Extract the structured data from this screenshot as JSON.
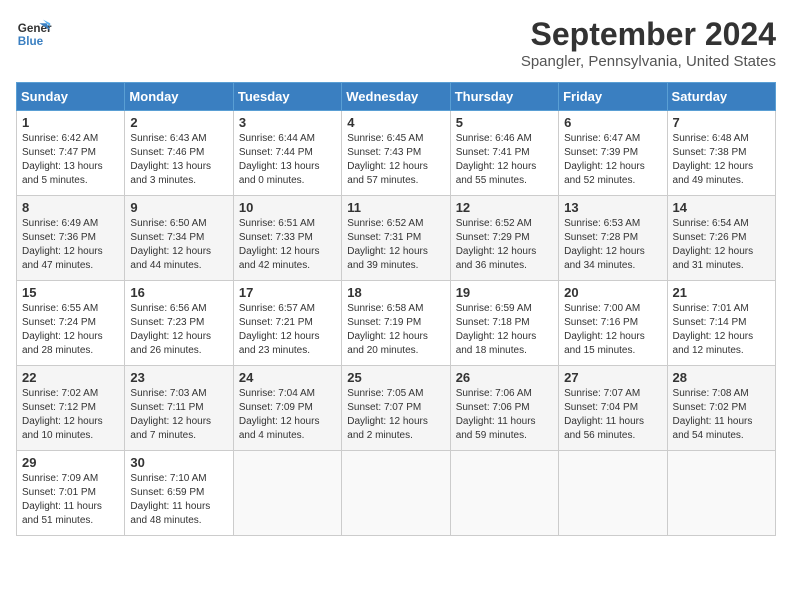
{
  "header": {
    "logo_line1": "General",
    "logo_line2": "Blue",
    "month": "September 2024",
    "location": "Spangler, Pennsylvania, United States"
  },
  "days_of_week": [
    "Sunday",
    "Monday",
    "Tuesday",
    "Wednesday",
    "Thursday",
    "Friday",
    "Saturday"
  ],
  "weeks": [
    [
      {
        "day": "1",
        "sunrise": "6:42 AM",
        "sunset": "7:47 PM",
        "daylight": "13 hours and 5 minutes."
      },
      {
        "day": "2",
        "sunrise": "6:43 AM",
        "sunset": "7:46 PM",
        "daylight": "13 hours and 3 minutes."
      },
      {
        "day": "3",
        "sunrise": "6:44 AM",
        "sunset": "7:44 PM",
        "daylight": "13 hours and 0 minutes."
      },
      {
        "day": "4",
        "sunrise": "6:45 AM",
        "sunset": "7:43 PM",
        "daylight": "12 hours and 57 minutes."
      },
      {
        "day": "5",
        "sunrise": "6:46 AM",
        "sunset": "7:41 PM",
        "daylight": "12 hours and 55 minutes."
      },
      {
        "day": "6",
        "sunrise": "6:47 AM",
        "sunset": "7:39 PM",
        "daylight": "12 hours and 52 minutes."
      },
      {
        "day": "7",
        "sunrise": "6:48 AM",
        "sunset": "7:38 PM",
        "daylight": "12 hours and 49 minutes."
      }
    ],
    [
      {
        "day": "8",
        "sunrise": "6:49 AM",
        "sunset": "7:36 PM",
        "daylight": "12 hours and 47 minutes."
      },
      {
        "day": "9",
        "sunrise": "6:50 AM",
        "sunset": "7:34 PM",
        "daylight": "12 hours and 44 minutes."
      },
      {
        "day": "10",
        "sunrise": "6:51 AM",
        "sunset": "7:33 PM",
        "daylight": "12 hours and 42 minutes."
      },
      {
        "day": "11",
        "sunrise": "6:52 AM",
        "sunset": "7:31 PM",
        "daylight": "12 hours and 39 minutes."
      },
      {
        "day": "12",
        "sunrise": "6:52 AM",
        "sunset": "7:29 PM",
        "daylight": "12 hours and 36 minutes."
      },
      {
        "day": "13",
        "sunrise": "6:53 AM",
        "sunset": "7:28 PM",
        "daylight": "12 hours and 34 minutes."
      },
      {
        "day": "14",
        "sunrise": "6:54 AM",
        "sunset": "7:26 PM",
        "daylight": "12 hours and 31 minutes."
      }
    ],
    [
      {
        "day": "15",
        "sunrise": "6:55 AM",
        "sunset": "7:24 PM",
        "daylight": "12 hours and 28 minutes."
      },
      {
        "day": "16",
        "sunrise": "6:56 AM",
        "sunset": "7:23 PM",
        "daylight": "12 hours and 26 minutes."
      },
      {
        "day": "17",
        "sunrise": "6:57 AM",
        "sunset": "7:21 PM",
        "daylight": "12 hours and 23 minutes."
      },
      {
        "day": "18",
        "sunrise": "6:58 AM",
        "sunset": "7:19 PM",
        "daylight": "12 hours and 20 minutes."
      },
      {
        "day": "19",
        "sunrise": "6:59 AM",
        "sunset": "7:18 PM",
        "daylight": "12 hours and 18 minutes."
      },
      {
        "day": "20",
        "sunrise": "7:00 AM",
        "sunset": "7:16 PM",
        "daylight": "12 hours and 15 minutes."
      },
      {
        "day": "21",
        "sunrise": "7:01 AM",
        "sunset": "7:14 PM",
        "daylight": "12 hours and 12 minutes."
      }
    ],
    [
      {
        "day": "22",
        "sunrise": "7:02 AM",
        "sunset": "7:12 PM",
        "daylight": "12 hours and 10 minutes."
      },
      {
        "day": "23",
        "sunrise": "7:03 AM",
        "sunset": "7:11 PM",
        "daylight": "12 hours and 7 minutes."
      },
      {
        "day": "24",
        "sunrise": "7:04 AM",
        "sunset": "7:09 PM",
        "daylight": "12 hours and 4 minutes."
      },
      {
        "day": "25",
        "sunrise": "7:05 AM",
        "sunset": "7:07 PM",
        "daylight": "12 hours and 2 minutes."
      },
      {
        "day": "26",
        "sunrise": "7:06 AM",
        "sunset": "7:06 PM",
        "daylight": "11 hours and 59 minutes."
      },
      {
        "day": "27",
        "sunrise": "7:07 AM",
        "sunset": "7:04 PM",
        "daylight": "11 hours and 56 minutes."
      },
      {
        "day": "28",
        "sunrise": "7:08 AM",
        "sunset": "7:02 PM",
        "daylight": "11 hours and 54 minutes."
      }
    ],
    [
      {
        "day": "29",
        "sunrise": "7:09 AM",
        "sunset": "7:01 PM",
        "daylight": "11 hours and 51 minutes."
      },
      {
        "day": "30",
        "sunrise": "7:10 AM",
        "sunset": "6:59 PM",
        "daylight": "11 hours and 48 minutes."
      },
      null,
      null,
      null,
      null,
      null
    ]
  ]
}
